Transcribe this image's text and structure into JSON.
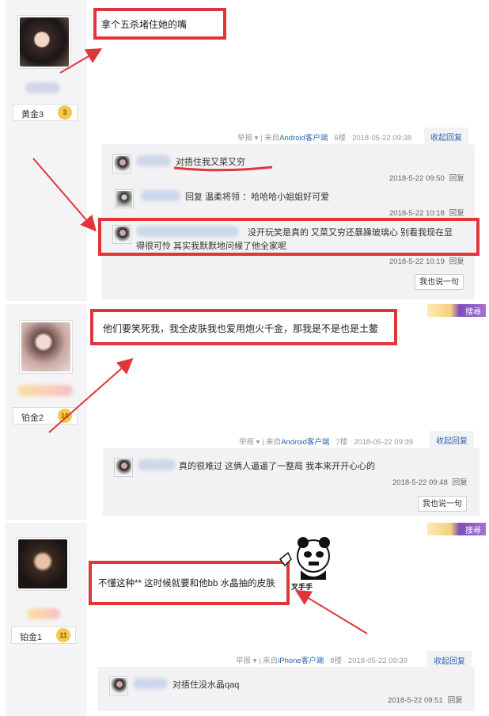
{
  "posts": [
    {
      "level": "黄金3",
      "level_num": "3",
      "content": "拿个五杀堵住她的嘴",
      "report": "举报",
      "source_prefix": "来自",
      "source": "Android客户端",
      "floor": "6楼",
      "time": "2018-05-22 09:38",
      "collapse": "收起回复",
      "replies": [
        {
          "text": "对捂住我又菜又穷",
          "time": "2018-5-22 09:50",
          "reply_label": "回复"
        },
        {
          "text": "回复 温柔将领 ：哈哈哈小姐姐好可爱",
          "time": "2018-5-22 10:18",
          "reply_label": "回复"
        },
        {
          "text": "没开玩笑是真的 又菜又穷还暴躁玻璃心 别看我现在显",
          "text2": "得很可怜 其实我默默地问候了他全家呢",
          "time": "2018-5-22 10:19",
          "reply_label": "回复"
        }
      ],
      "say_button": "我也说一句"
    },
    {
      "level": "铂金2",
      "level_num": "10",
      "content": "他们要笑死我，我全皮肤我也爱用炮火千金，那我是不是也是土鳖",
      "report": "举报",
      "source_prefix": "来自",
      "source": "Android客户端",
      "floor": "7楼",
      "time": "2018-05-22 09:39",
      "collapse": "收起回复",
      "replies": [
        {
          "text": "真的很难过 这俩人逼逼了一整局 我本来开开心心的",
          "time": "2018-5-22 09:48",
          "reply_label": "回复"
        }
      ],
      "say_button": "我也说一句"
    },
    {
      "level": "铂金1",
      "level_num": "11",
      "content": "不懂这种** 这时候就要和他bb 水晶抽的皮肤",
      "sticker_text": "叉手手",
      "report": "举报",
      "source_prefix": "来自",
      "source": "iPhone客户端",
      "floor": "8楼",
      "time": "2018-05-22 09:39",
      "collapse": "收起回复",
      "replies": [
        {
          "text": "对捂住没水晶qaq",
          "time": "2018-5-22 09:51",
          "reply_label": "回复"
        }
      ]
    }
  ],
  "ad_label": "搜尋",
  "colors": {
    "highlight": "#e0363b",
    "link": "#2d64b3",
    "sidebar": "#f4f4f6",
    "reply_bg": "#f2f2f4"
  }
}
